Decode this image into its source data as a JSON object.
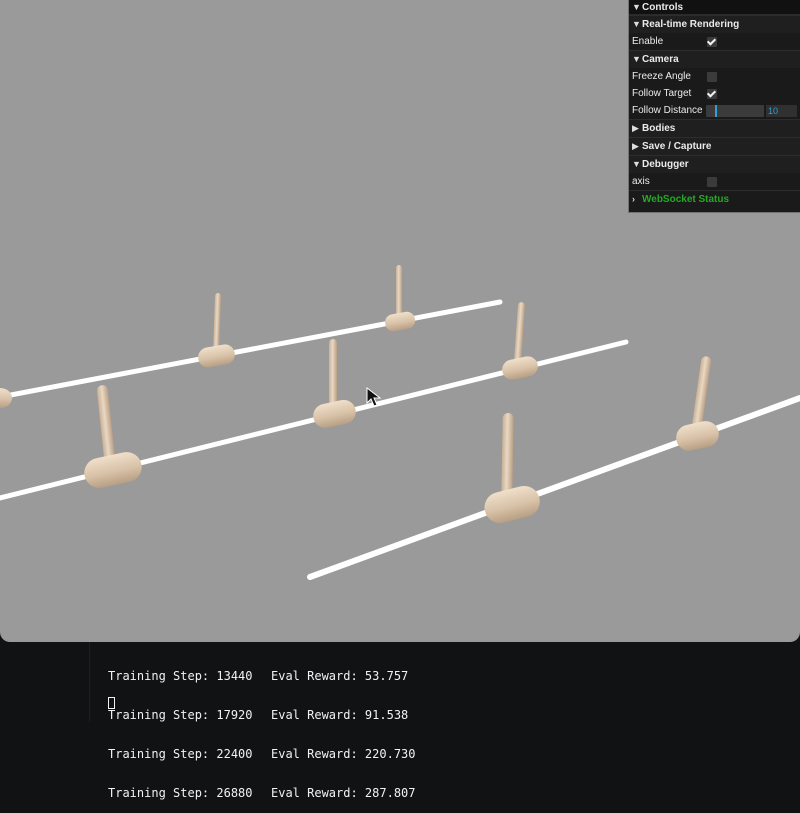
{
  "panel": {
    "title": "Controls",
    "realtime": {
      "title": "Real-time Rendering",
      "enable_label": "Enable",
      "enable_checked": true
    },
    "camera": {
      "title": "Camera",
      "freeze_angle_label": "Freeze Angle",
      "freeze_angle_checked": false,
      "follow_target_label": "Follow Target",
      "follow_target_checked": true,
      "follow_distance_label": "Follow Distance",
      "follow_distance_value": "10"
    },
    "bodies_title": "Bodies",
    "save_capture_title": "Save / Capture",
    "debugger": {
      "title": "Debugger",
      "axis_label": "axis",
      "axis_checked": false
    },
    "websocket_status": "WebSocket Status"
  },
  "icons": {
    "expanded": "chevron-down-icon",
    "collapsed": "chevron-right-icon",
    "mouse_cursor": "mouse-cursor-icon"
  },
  "terminal": {
    "rows": [
      {
        "training_step": "Training Step: 13440",
        "eval_reward": "Eval Reward: 53.757"
      },
      {
        "training_step": "Training Step: 17920",
        "eval_reward": "Eval Reward: 91.538"
      },
      {
        "training_step": "Training Step: 22400",
        "eval_reward": "Eval Reward: 220.730"
      },
      {
        "training_step": "Training Step: 26880",
        "eval_reward": "Eval Reward: 287.807"
      }
    ]
  },
  "colors": {
    "viewport_background": "#9a9a9a",
    "body_tan": "#d9c3aa",
    "accent_blue": "#2fa1d6",
    "websocket_green": "#22aa22",
    "terminal_background": "#111214"
  }
}
